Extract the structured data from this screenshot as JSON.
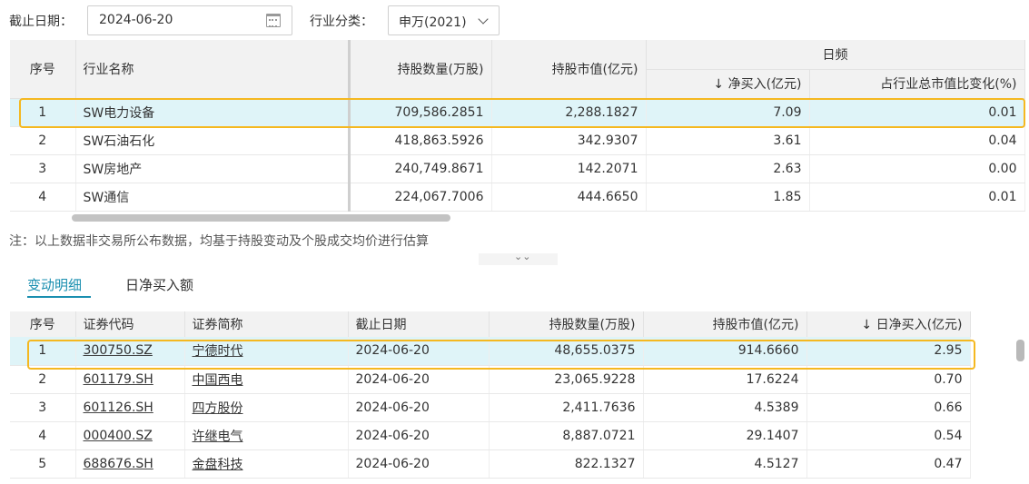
{
  "filters": {
    "date_label": "截止日期：",
    "date_value": "2024-06-20",
    "industry_label": "行业分类：",
    "industry_value": "申万(2021)"
  },
  "top_table": {
    "headers": {
      "seq": "序号",
      "name": "行业名称",
      "shares": "持股数量(万股)",
      "value": "持股市值(亿元)",
      "group": "日频",
      "net_buy": "↓ 净买入(亿元)",
      "ratio": "占行业总市值比变化(%)"
    },
    "rows": [
      {
        "seq": "1",
        "name": "SW电力设备",
        "shares": "709,586.2851",
        "value": "2,288.1827",
        "net_buy": "7.09",
        "ratio": "0.01"
      },
      {
        "seq": "2",
        "name": "SW石油石化",
        "shares": "418,863.5926",
        "value": "342.9307",
        "net_buy": "3.61",
        "ratio": "0.04"
      },
      {
        "seq": "3",
        "name": "SW房地产",
        "shares": "240,749.8671",
        "value": "142.2071",
        "net_buy": "2.63",
        "ratio": "0.00"
      },
      {
        "seq": "4",
        "name": "SW通信",
        "shares": "224,067.7006",
        "value": "444.6650",
        "net_buy": "1.85",
        "ratio": "0.01"
      }
    ]
  },
  "note": "注：以上数据非交易所公布数据，均基于持股变动及个股成交均价进行估算",
  "tabs": [
    "变动明细",
    "日净买入额"
  ],
  "bottom_table": {
    "headers": {
      "seq": "序号",
      "code": "证券代码",
      "name": "证券简称",
      "date": "截止日期",
      "shares": "持股数量(万股)",
      "value": "持股市值(亿元)",
      "net_buy": "↓ 日净买入(亿元)"
    },
    "rows": [
      {
        "seq": "1",
        "code": "300750.SZ",
        "name": "宁德时代",
        "date": "2024-06-20",
        "shares": "48,655.0375",
        "value": "914.6660",
        "net_buy": "2.95"
      },
      {
        "seq": "2",
        "code": "601179.SH",
        "name": "中国西电",
        "date": "2024-06-20",
        "shares": "23,065.9228",
        "value": "17.6224",
        "net_buy": "0.70"
      },
      {
        "seq": "3",
        "code": "601126.SH",
        "name": "四方股份",
        "date": "2024-06-20",
        "shares": "2,411.7636",
        "value": "4.5389",
        "net_buy": "0.66"
      },
      {
        "seq": "4",
        "code": "000400.SZ",
        "name": "许继电气",
        "date": "2024-06-20",
        "shares": "8,887.0721",
        "value": "29.1407",
        "net_buy": "0.54"
      },
      {
        "seq": "5",
        "code": "688676.SH",
        "name": "金盘科技",
        "date": "2024-06-20",
        "shares": "822.1327",
        "value": "4.5127",
        "net_buy": "0.47"
      }
    ]
  },
  "colors": {
    "accent": "#1a8fb0",
    "highlight_row": "#dff4f8",
    "highlight_box": "#f5b820",
    "header_bg": "#f2f2f2"
  }
}
